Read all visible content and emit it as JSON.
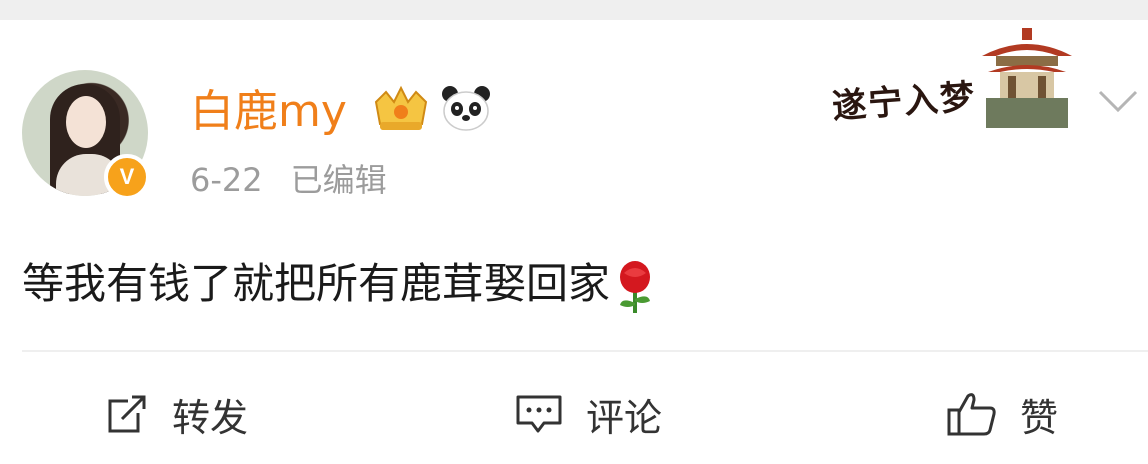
{
  "post": {
    "author": "白鹿my",
    "date": "6-22",
    "edited_label": "已编辑",
    "content": "等我有钱了就把所有鹿茸娶回家",
    "decor_stamp_text": "遂宁入梦",
    "verified_badge": "V"
  },
  "actions": {
    "repost": "转发",
    "comment": "评论",
    "like": "赞"
  },
  "colors": {
    "username": "#f07f1a",
    "verified": "#f7a21b",
    "meta": "#9c9c9c"
  },
  "icons": [
    "crown-badge-icon",
    "panda-icon",
    "chevron-down-icon",
    "rose-emoji-icon",
    "repost-icon",
    "comment-icon",
    "thumbs-up-icon"
  ]
}
